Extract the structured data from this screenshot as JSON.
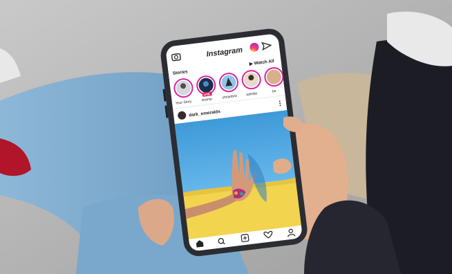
{
  "app": {
    "name": "Instagram"
  },
  "stories": {
    "header": "Stories",
    "watch_all": "▶ Watch All",
    "items": [
      {
        "label": "Your Story"
      },
      {
        "label": "stramp",
        "badge": "LIVE"
      },
      {
        "label": "chrianbrw"
      },
      {
        "label": "adriolio"
      },
      {
        "label": "be"
      }
    ]
  },
  "post": {
    "username": "dark_emeralds"
  },
  "icons": {
    "camera": "camera-icon",
    "direct": "paper-plane-icon",
    "home": "home-icon",
    "search": "search-icon",
    "add": "add-post-icon",
    "activity": "heart-icon",
    "profile": "profile-icon",
    "more": "more-icon"
  },
  "colors": {
    "story_ring": "#d6249f",
    "live_badge": "#e1306c",
    "post_sky": "#4aa3df",
    "post_ground": "#f2d44f"
  }
}
